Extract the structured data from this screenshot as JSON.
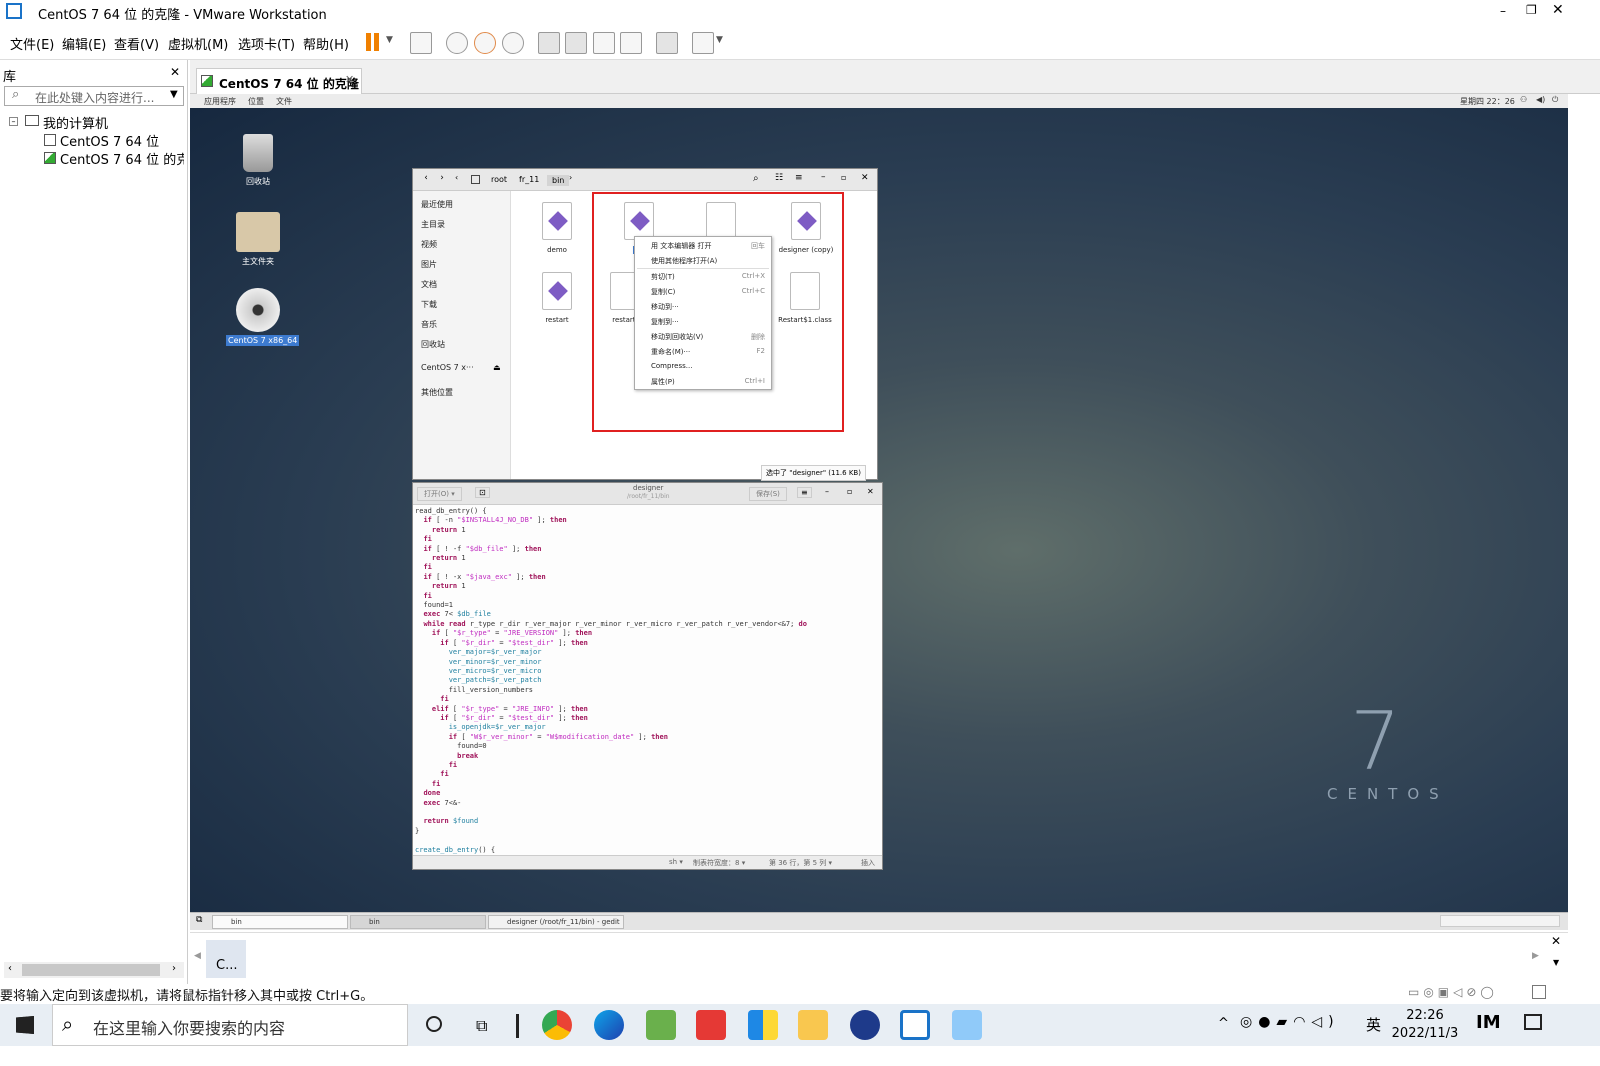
{
  "window": {
    "title": "CentOS 7 64 位 的克隆 - VMware Workstation"
  },
  "menu": [
    "文件(E)",
    "编辑(E)",
    "查看(V)",
    "虚拟机(M)",
    "选项卡(T)",
    "帮助(H)"
  ],
  "library": {
    "header": "库",
    "search_placeholder": "在此处键入内容进行...",
    "tree": {
      "root": "我的计算机",
      "vm1": "CentOS 7 64 位",
      "vm2": "CentOS 7 64 位 的克"
    }
  },
  "vm_tab": {
    "label": "CentOS 7 64 位 的克隆"
  },
  "guest_topbar": {
    "apps": "应用程序",
    "places": "位置",
    "files": "文件",
    "time": "星期四 22：26"
  },
  "desktop_icons": [
    {
      "name": "trash",
      "label": "回收站"
    },
    {
      "name": "home",
      "label": "主文件夹"
    },
    {
      "name": "disc",
      "label": "CentOS 7 x86_64"
    }
  ],
  "file_manager": {
    "breadcrumb": [
      "root",
      "fr_11",
      "bin"
    ],
    "sidebar": [
      "最近使用",
      "主目录",
      "视频",
      "图片",
      "文档",
      "下载",
      "音乐",
      "回收站",
      "CentOS 7 x···",
      "其他位置"
    ],
    "files": [
      {
        "name": "demo",
        "type": "script"
      },
      {
        "name": "de",
        "type": "script"
      },
      {
        "name": "",
        "type": "text"
      },
      {
        "name": "designer (copy)",
        "type": "script"
      },
      {
        "name": "restart",
        "type": "script"
      },
      {
        "name": "restart.",
        "type": "text"
      },
      {
        "name": "Restart$1.class",
        "type": "text"
      }
    ],
    "status": "选中了 \"designer\" (11.6 KB)"
  },
  "context_menu": [
    {
      "label": "用 文本编辑器 打开",
      "key": "回车"
    },
    {
      "label": "使用其他程序打开(A)",
      "key": ""
    },
    {
      "label": "剪切(T)",
      "key": "Ctrl+X"
    },
    {
      "label": "复制(C)",
      "key": "Ctrl+C"
    },
    {
      "label": "移动到···",
      "key": ""
    },
    {
      "label": "复制到···",
      "key": ""
    },
    {
      "label": "移动到回收站(V)",
      "key": "删除"
    },
    {
      "label": "重命名(M)···",
      "key": "F2"
    },
    {
      "label": "Compress...",
      "key": ""
    },
    {
      "label": "属性(P)",
      "key": "Ctrl+I"
    }
  ],
  "gedit": {
    "open_label": "打开(O)",
    "title": "designer",
    "subtitle": "/root/fr_11/bin",
    "save_label": "保存(S)",
    "status": {
      "lang": "sh",
      "tab": "制表符宽度：8",
      "pos": "第 36 行，第 5 列",
      "mode": "插入"
    }
  },
  "centos_logo": {
    "numeral": "7",
    "word": "CENTOS"
  },
  "guest_taskbar": [
    "bin",
    "bin",
    "designer (/root/fr_11/bin) - gedit"
  ],
  "thumb_label": "C...",
  "status_bar": "要将输入定向到该虚拟机，请将鼠标指针移入其中或按 Ctrl+G。",
  "windows_taskbar": {
    "search_placeholder": "在这里输入你要搜索的内容",
    "ime": "英",
    "time": "22:26",
    "date": "2022/11/3"
  },
  "colors": {
    "highlight": "#e02020",
    "selection": "#3d7bd0",
    "accent": "#f08000"
  }
}
